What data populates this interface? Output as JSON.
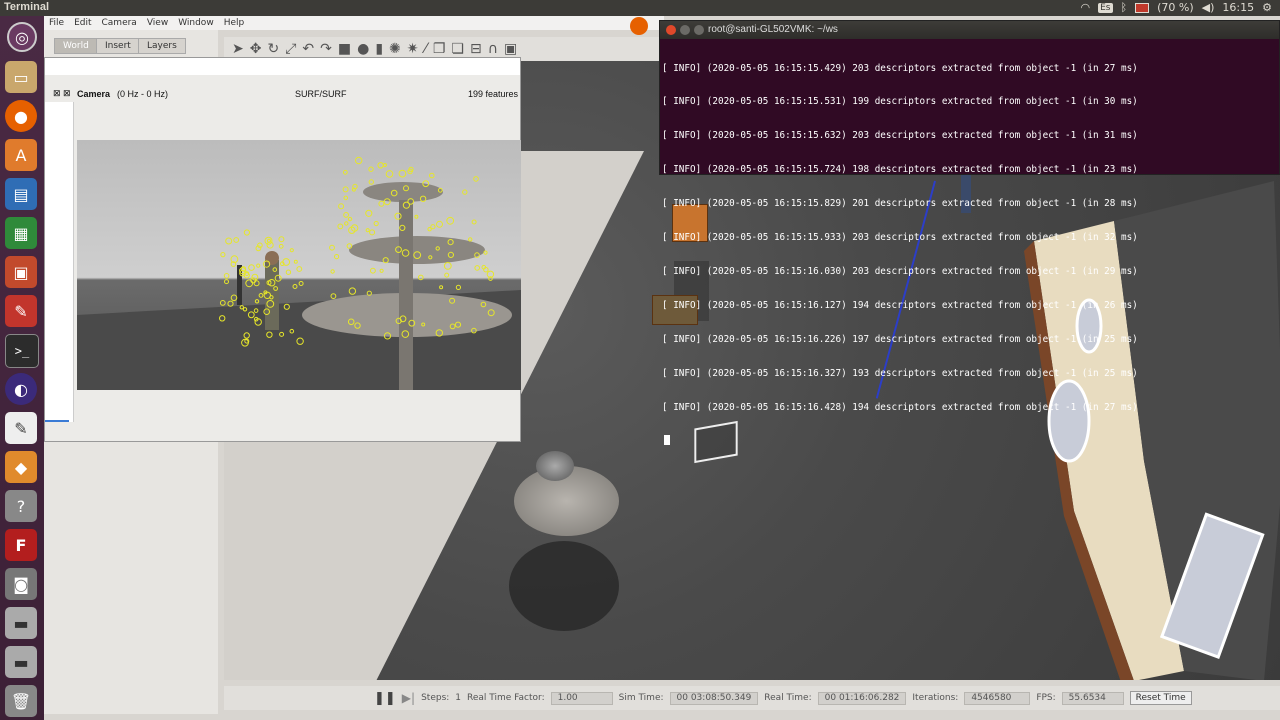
{
  "topbar": {
    "app_title": "Terminal",
    "keyboard_layout": "Es",
    "battery": "(70 %)",
    "clock": "16:15"
  },
  "launcher": {
    "items": [
      "ubuntu-icon",
      "files-icon",
      "firefox-icon",
      "software-center-icon",
      "writer-icon",
      "calc-icon",
      "impress-icon",
      "settings-icon",
      "terminal-icon",
      "eclipse-icon",
      "text-editor-icon",
      "gazebo-icon",
      "help-icon",
      "fritzing-icon",
      "camera-icon",
      "drive-icon",
      "drive-icon",
      "trash-icon"
    ]
  },
  "gazebo": {
    "menu": [
      "File",
      "Edit",
      "Camera",
      "View",
      "Window",
      "Help"
    ],
    "tabs": [
      "World",
      "Insert",
      "Layers"
    ],
    "bottom": {
      "steps_label": "Steps:",
      "steps_value": "1",
      "rtf_label": "Real Time Factor:",
      "rtf_value": "1.00",
      "sim_time_label": "Sim Time:",
      "sim_time_value": "00 03:08:50.349",
      "real_time_label": "Real Time:",
      "real_time_value": "00 01:16:06.282",
      "iterations_label": "Iterations:",
      "iterations_value": "4546580",
      "fps_label": "FPS:",
      "fps_value": "55.6534",
      "reset_label": "Reset Time"
    }
  },
  "camera_window": {
    "title": "Camera",
    "rate": "(0 Hz - 0 Hz)",
    "algorithm": "SURF/SURF",
    "features": "199 features"
  },
  "terminal": {
    "title": "root@santi-GL502VMK: ~/ws",
    "lines": [
      "[ INFO] (2020-05-05 16:15:15.429) 203 descriptors extracted from object -1 (in 27 ms)",
      "[ INFO] (2020-05-05 16:15:15.531) 199 descriptors extracted from object -1 (in 30 ms)",
      "[ INFO] (2020-05-05 16:15:15.632) 203 descriptors extracted from object -1 (in 31 ms)",
      "[ INFO] (2020-05-05 16:15:15.724) 198 descriptors extracted from object -1 (in 23 ms)",
      "[ INFO] (2020-05-05 16:15:15.829) 201 descriptors extracted from object -1 (in 28 ms)",
      "[ INFO] (2020-05-05 16:15:15.933) 203 descriptors extracted from object -1 (in 32 ms)",
      "[ INFO] (2020-05-05 16:15:16.030) 203 descriptors extracted from object -1 (in 29 ms)",
      "[ INFO] (2020-05-05 16:15:16.127) 194 descriptors extracted from object -1 (in 26 ms)",
      "[ INFO] (2020-05-05 16:15:16.226) 197 descriptors extracted from object -1 (in 25 ms)",
      "[ INFO] (2020-05-05 16:15:16.327) 193 descriptors extracted from object -1 (in 25 ms)",
      "[ INFO] (2020-05-05 16:15:16.428) 194 descriptors extracted from object -1 (in 27 ms)"
    ]
  }
}
